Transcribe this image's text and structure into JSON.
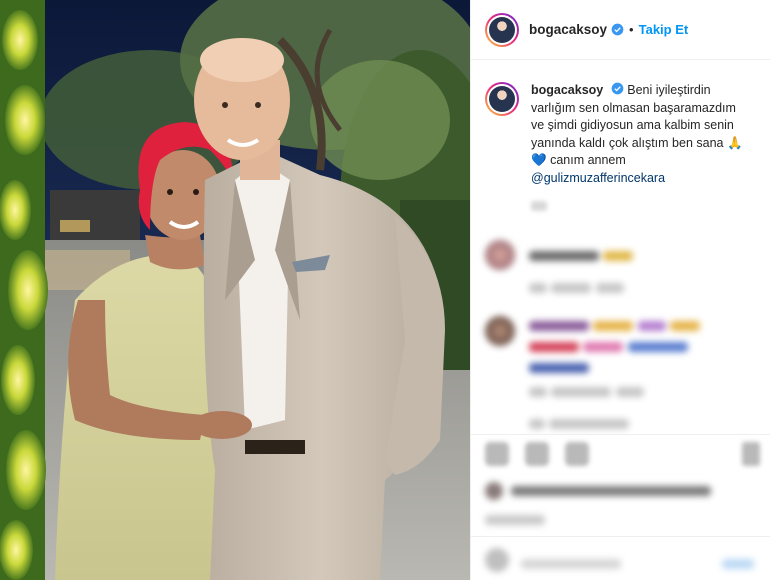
{
  "post": {
    "username": "bogacaksoy",
    "follow_label": "Takip Et",
    "separator": "•",
    "caption": {
      "username": "bogacaksoy",
      "line1": "Beni iyileştirdin",
      "line2": "varlığım sen olmasan başaramazdım",
      "line3": "ve şimdi gidiyosun ama kalbim senin",
      "line4": "yanında kaldı çok alıştım ben sana",
      "emoji_pray": "🙏",
      "emoji_heart": "💙",
      "line5": "canım annem",
      "mention": "@gulizmuzafferincekara"
    }
  },
  "icons": {
    "verified": "verified-badge-icon",
    "like": "heart-icon",
    "comment": "comment-icon",
    "share": "share-icon",
    "save": "bookmark-icon",
    "emoji": "emoji-icon"
  },
  "colors": {
    "follow_blue": "#0095f6",
    "verified_blue": "#3897f0",
    "mention_blue": "#00376b",
    "text": "#262626",
    "divider": "#efefef"
  }
}
